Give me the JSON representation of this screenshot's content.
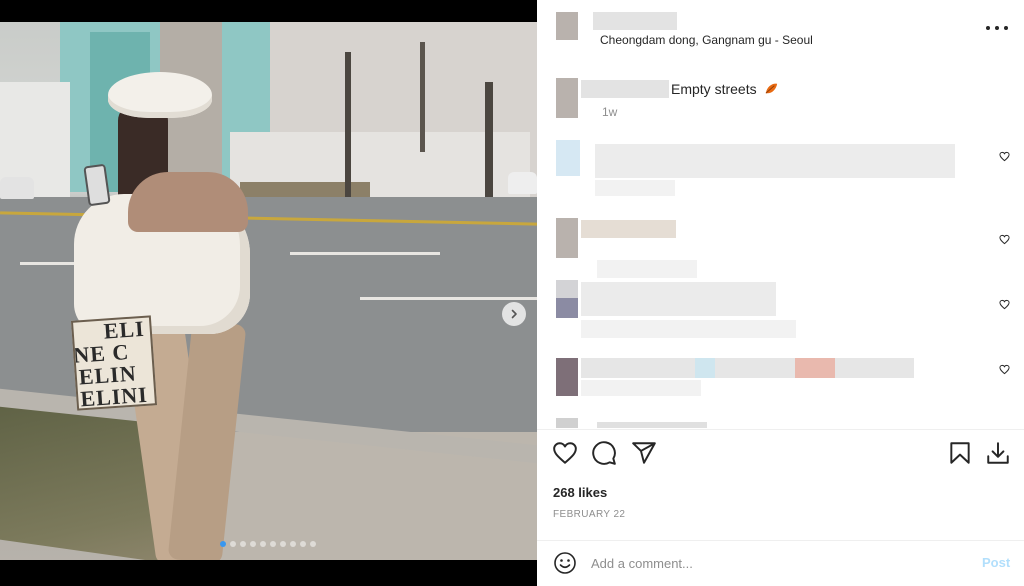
{
  "post": {
    "location": "Cheongdam dong, Gangnam gu - Seoul",
    "caption": "Empty streets",
    "caption_emoji": "fallen-leaf-emoji",
    "time_ago": "1w",
    "likes": "268 likes",
    "date": "FEBRUARY 22"
  },
  "photo": {
    "bag_lines": [
      "ELI",
      "NE C",
      "ELIN",
      "ELINI"
    ]
  },
  "carousel": {
    "total": 10,
    "active": 0
  },
  "comment_box": {
    "placeholder": "Add a comment...",
    "post_label": "Post"
  },
  "colors": {
    "link_disabled": "#b2dffc",
    "muted": "#8e8e8e",
    "text": "#262626",
    "carousel_active": "#3897f0"
  },
  "icons": [
    "more-icon",
    "heart-icon",
    "comment-icon",
    "share-icon",
    "bookmark-icon",
    "download-icon",
    "emoji-icon",
    "chevron-right-icon"
  ]
}
